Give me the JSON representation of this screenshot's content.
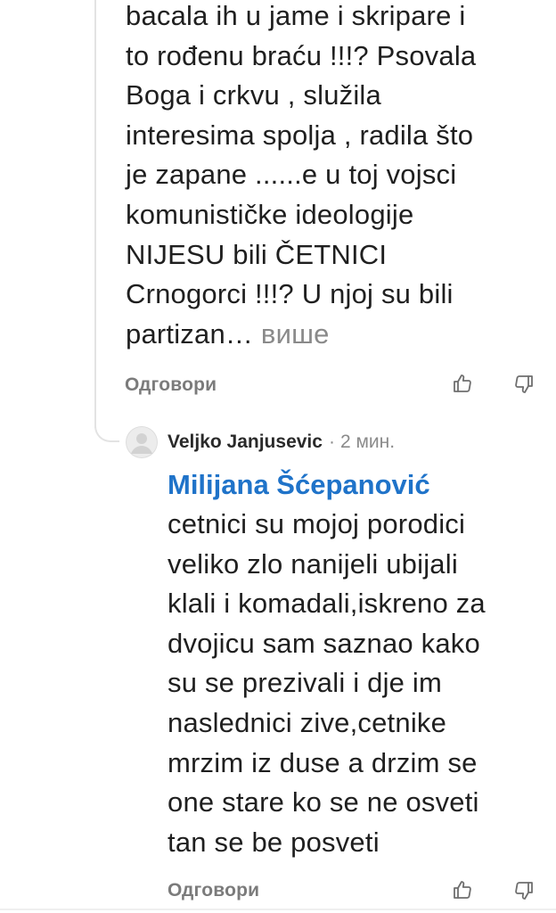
{
  "first_comment": {
    "lines": [
      "bacala ih u jame i skripare i",
      "to rođenu braću !!!? Psovala",
      "Boga i crkvu , služila",
      "interesima spolja , radila što",
      "je zapane ......e u toj vojsci",
      "komunističke ideologije",
      "NIJESU bili ČETNICI",
      "Crnogorci !!!? U njoj su bili"
    ],
    "last_line_text": "partizan…",
    "more_label": "више",
    "reply_label": "Одговори"
  },
  "reply_comment": {
    "author": "Veljko Janjusevic",
    "separator": "·",
    "time": "2 мин.",
    "mention": "Milijana Šćepanović",
    "lines": [
      "cetnici su mojoj porodici",
      "veliko zlo nanijeli ubijali",
      "klali i komadali,iskreno za",
      "dvojicu sam saznao kako",
      "su se prezivali i dje im",
      "naslednici zive,cetnike",
      "mrzim iz duse a drzim se",
      "one stare ko se ne osveti",
      "tan se be posveti"
    ],
    "reply_label": "Одговори"
  },
  "icons": {
    "like": "thumbs-up-icon",
    "dislike": "thumbs-down-icon",
    "avatar": "default-avatar-icon"
  },
  "colors": {
    "mention": "#1f73c9",
    "muted": "#8a8a8a",
    "text": "#1f1f1f",
    "thread_line": "#e3e3e3"
  }
}
